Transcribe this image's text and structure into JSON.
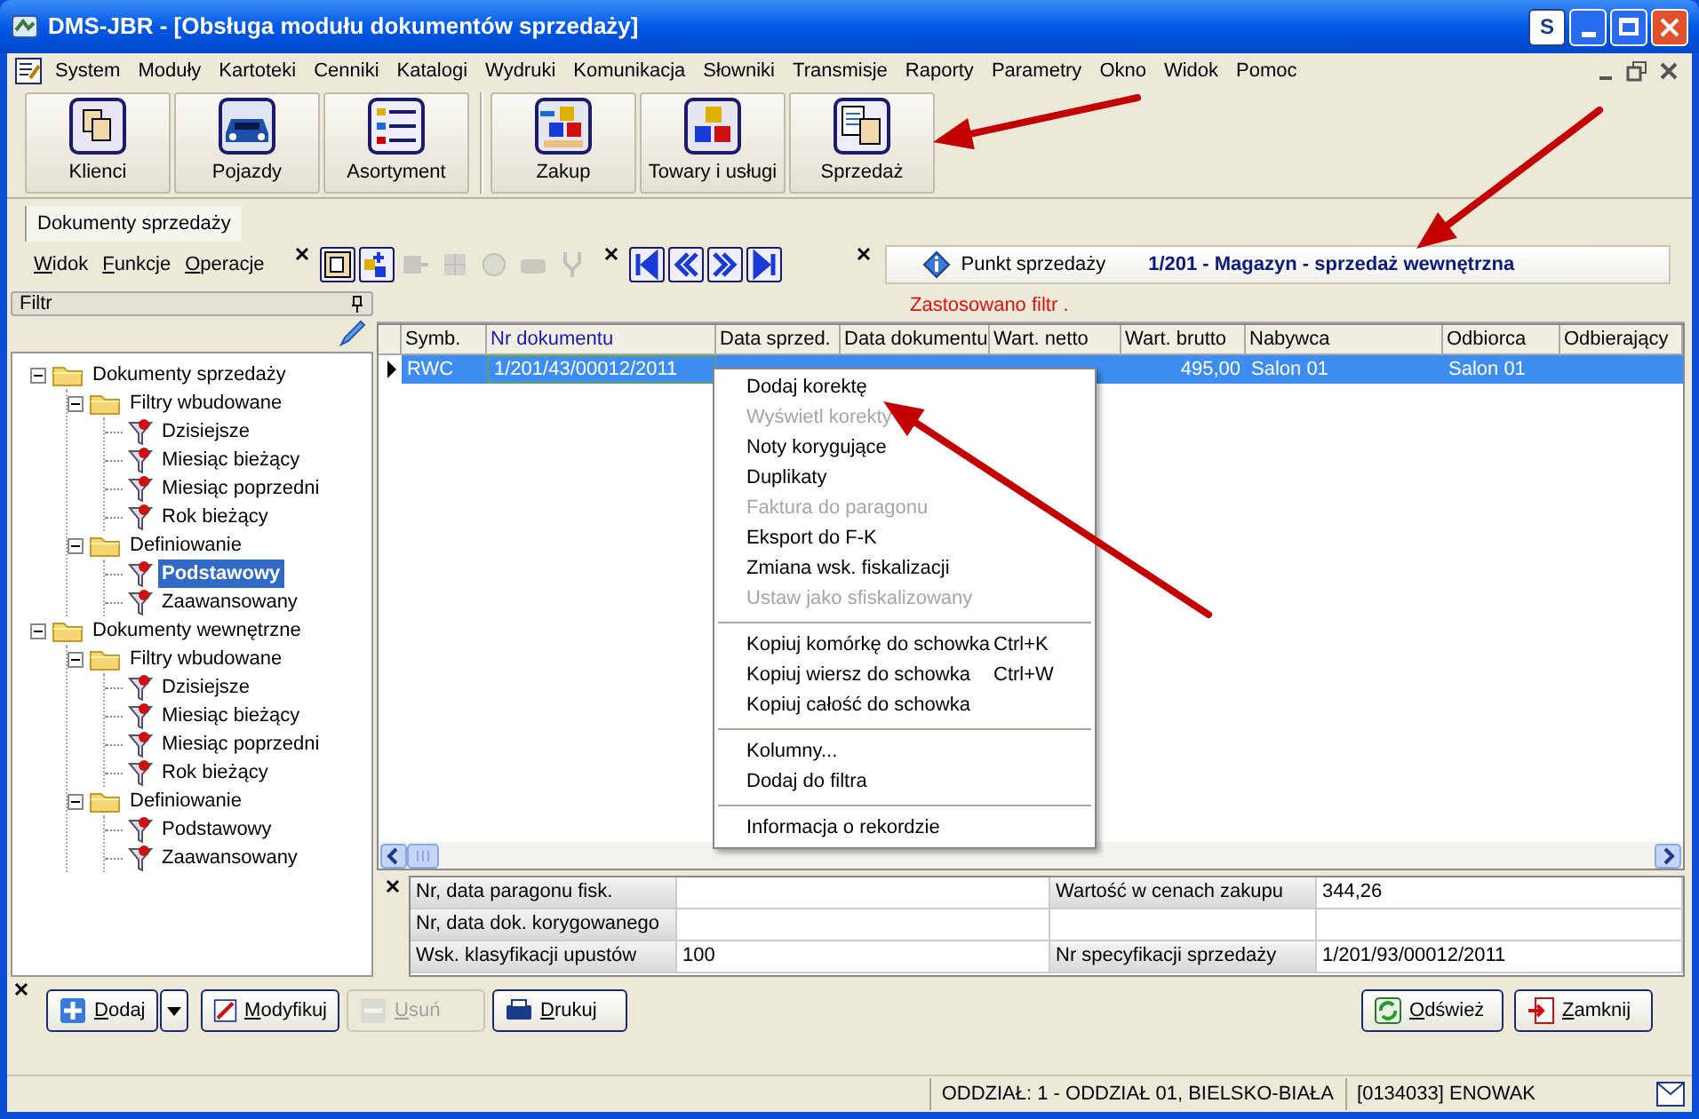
{
  "window": {
    "title": "DMS-JBR - [Obsługa modułu dokumentów sprzedaży]",
    "s_button": "S"
  },
  "menu": [
    "System",
    "Moduły",
    "Kartoteki",
    "Cenniki",
    "Katalogi",
    "Wydruki",
    "Komunikacja",
    "Słowniki",
    "Transmisje",
    "Raporty",
    "Parametry",
    "Okno",
    "Widok",
    "Pomoc"
  ],
  "toolbar": [
    {
      "label": "Klienci"
    },
    {
      "label": "Pojazdy"
    },
    {
      "label": "Asortyment"
    },
    {
      "label": "Zakup"
    },
    {
      "label": "Towary i usługi"
    },
    {
      "label": "Sprzedaż"
    }
  ],
  "tabs": [
    {
      "label": "Dokumenty sprzedaży",
      "selected": true
    }
  ],
  "sub_menu": [
    "Widok",
    "Funkcje",
    "Operacje"
  ],
  "action_icons": [
    {
      "disabled": false
    },
    {
      "disabled": false
    },
    {
      "disabled": true
    },
    {
      "disabled": true
    },
    {
      "disabled": true
    },
    {
      "disabled": true
    },
    {
      "disabled": true
    }
  ],
  "point_of_sale": {
    "label": "Punkt sprzedaży",
    "value": "1/201 - Magazyn - sprzedaż wewnętrzna"
  },
  "filter_panel": {
    "title": "Filtr",
    "tree": [
      {
        "label": "Dokumenty sprzedaży",
        "kind": "folder",
        "expanded": true,
        "selected": false,
        "children": [
          {
            "label": "Filtry wbudowane",
            "kind": "folder",
            "expanded": true,
            "selected": false,
            "children": [
              {
                "label": "Dzisiejsze",
                "kind": "filter",
                "selected": false
              },
              {
                "label": "Miesiąc bieżący",
                "kind": "filter",
                "selected": false
              },
              {
                "label": "Miesiąc poprzedni",
                "kind": "filter",
                "selected": false
              },
              {
                "label": "Rok bieżący",
                "kind": "filter",
                "selected": false
              }
            ]
          },
          {
            "label": "Definiowanie",
            "kind": "folder",
            "expanded": true,
            "selected": false,
            "children": [
              {
                "label": "Podstawowy",
                "kind": "filter",
                "selected": true
              },
              {
                "label": "Zaawansowany",
                "kind": "filter",
                "selected": false
              }
            ]
          }
        ]
      },
      {
        "label": "Dokumenty wewnętrzne",
        "kind": "folder",
        "expanded": true,
        "selected": false,
        "children": [
          {
            "label": "Filtry wbudowane",
            "kind": "folder",
            "expanded": true,
            "selected": false,
            "children": [
              {
                "label": "Dzisiejsze",
                "kind": "filter",
                "selected": false
              },
              {
                "label": "Miesiąc bieżący",
                "kind": "filter",
                "selected": false
              },
              {
                "label": "Miesiąc poprzedni",
                "kind": "filter",
                "selected": false
              },
              {
                "label": "Rok bieżący",
                "kind": "filter",
                "selected": false
              }
            ]
          },
          {
            "label": "Definiowanie",
            "kind": "folder",
            "expanded": true,
            "selected": false,
            "children": [
              {
                "label": "Podstawowy",
                "kind": "filter",
                "selected": false
              },
              {
                "label": "Zaawansowany",
                "kind": "filter",
                "selected": false
              }
            ]
          }
        ]
      }
    ]
  },
  "filter_notice": "Zastosowano filtr .",
  "table": {
    "columns": [
      {
        "label": "Symb.",
        "sorted": false
      },
      {
        "label": "Nr dokumentu",
        "sorted": true
      },
      {
        "label": "Data sprzed.",
        "sorted": false
      },
      {
        "label": "Data dokumentu",
        "sorted": false
      },
      {
        "label": "Wart. netto",
        "sorted": false
      },
      {
        "label": "Wart. brutto",
        "sorted": false
      },
      {
        "label": "Nabywca",
        "sorted": false
      },
      {
        "label": "Odbiorca",
        "sorted": false
      },
      {
        "label": "Odbierający",
        "sorted": false
      }
    ],
    "rows": [
      {
        "selected": true,
        "cells": [
          "RWC",
          "1/201/43/00012/2011",
          null,
          null,
          null,
          "495,00",
          "Salon 01",
          "Salon 01",
          null
        ]
      }
    ]
  },
  "context_menu": [
    {
      "kind": "item",
      "label": "Dodaj korektę",
      "disabled": false
    },
    {
      "kind": "item",
      "label": "Wyświetl korekty",
      "disabled": true
    },
    {
      "kind": "item",
      "label": "Noty korygujące",
      "disabled": false
    },
    {
      "kind": "item",
      "label": "Duplikaty",
      "disabled": false
    },
    {
      "kind": "item",
      "label": "Faktura do paragonu",
      "disabled": true
    },
    {
      "kind": "item",
      "label": "Eksport do F-K",
      "disabled": false
    },
    {
      "kind": "item",
      "label": "Zmiana wsk. fiskalizacji",
      "disabled": false
    },
    {
      "kind": "item",
      "label": "Ustaw jako sfiskalizowany",
      "disabled": true
    },
    {
      "kind": "separator"
    },
    {
      "kind": "item",
      "label": "Kopiuj komórkę do schowka",
      "shortcut": "Ctrl+K",
      "disabled": false
    },
    {
      "kind": "item",
      "label": "Kopiuj wiersz do schowka",
      "shortcut": "Ctrl+W",
      "disabled": false
    },
    {
      "kind": "item",
      "label": "Kopiuj całość do schowka",
      "disabled": false
    },
    {
      "kind": "separator"
    },
    {
      "kind": "item",
      "label": "Kolumny...",
      "disabled": false
    },
    {
      "kind": "item",
      "label": "Dodaj do filtra",
      "disabled": false
    },
    {
      "kind": "separator"
    },
    {
      "kind": "item",
      "label": "Informacja o rekordzie",
      "disabled": false
    }
  ],
  "details": [
    {
      "label": "Nr, data paragonu fisk.",
      "label_2": "Wartość w cenach zakupu",
      "value_2": "344,26"
    },
    {
      "label": "Nr, data dok. korygowanego"
    },
    {
      "label": "Wsk. klasyfikacji upustów",
      "value": "100",
      "label_2": "Nr specyfikacji sprzedaży",
      "value_2": "1/201/93/00012/2011"
    }
  ],
  "buttons_left": [
    {
      "label": "Dodaj",
      "disabled": false
    },
    {
      "label": "Modyfikuj",
      "disabled": false
    },
    {
      "label": "Usuń",
      "disabled": true
    },
    {
      "label": "Drukuj",
      "disabled": false
    }
  ],
  "buttons_right": [
    {
      "label": "Odśwież",
      "disabled": false
    },
    {
      "label": "Zamknij",
      "disabled": false
    }
  ],
  "status_bar": [
    "ODDZIAŁ: 1 - ODDZIAŁ 01, BIELSKO-BIAŁA",
    "[0134033] ENOWAK"
  ]
}
